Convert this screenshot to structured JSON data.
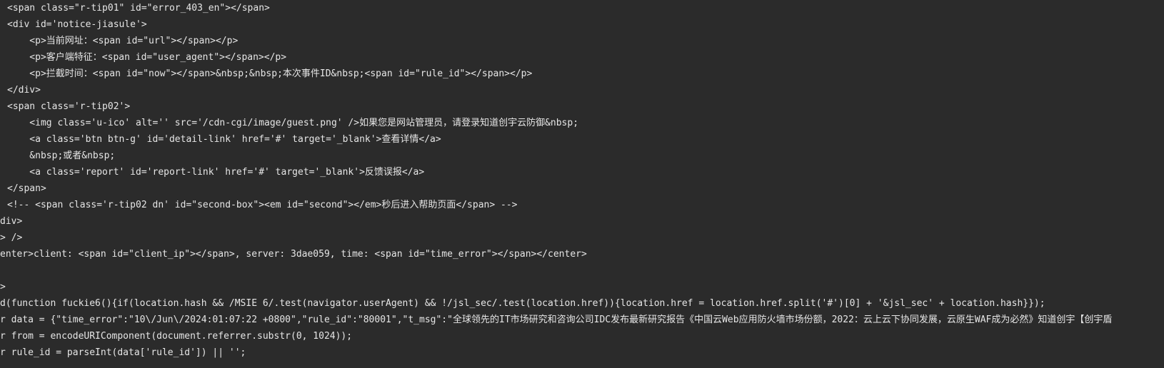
{
  "source_view": {
    "lines": [
      "<span class=\"r-tip01\" id=\"error_403_en\"></span>",
      "<div id='notice-jiasule'>",
      "    <p>当前网址：<span id=\"url\"></span></p>",
      "    <p>客户端特征：<span id=\"user_agent\"></span></p>",
      "    <p>拦截时间：<span id=\"now\"></span>&nbsp;&nbsp;本次事件ID&nbsp;<span id=\"rule_id\"></span></p>",
      "</div>",
      "<span class='r-tip02'>",
      "    <img class='u-ico' alt='' src='/cdn-cgi/image/guest.png' />如果您是网站管理员，请登录知道创宇云防御&nbsp;",
      "    <a class='btn btn-g' id='detail-link' href='#' target='_blank'>查看详情</a>",
      "    &nbsp;或者&nbsp;",
      "    <a class='report' id='report-link' href='#' target='_blank'>反馈误报</a>",
      "</span>",
      "<!-- <span class='r-tip02 dn' id=\"second-box\"><em id=\"second\"></em>秒后进入帮助页面</span> -->",
      "div>",
      "> />",
      "enter>client: <span id=\"client_ip\"></span>, server: 3dae059, time: <span id=\"time_error\"></span></center>",
      "",
      ">",
      "d(function fuckie6(){if(location.hash && /MSIE 6/.test(navigator.userAgent) && !/jsl_sec/.test(location.href)){location.href = location.href.split('#')[0] + '&jsl_sec' + location.hash}});",
      "r data = {\"time_error\":\"10\\/Jun\\/2024:01:07:22 +0800\",\"rule_id\":\"80001\",\"t_msg\":\"全球领先的IT市场研究和咨询公司IDC发布最新研究报告《中国云Web应用防火墙市场份额，2022：云上云下协同发展，云原生WAF成为必然》知道创宇【创宇盾",
      "r from = encodeURIComponent(document.referrer.substr(0, 1024));",
      "r rule_id = parseInt(data['rule_id']) || '';"
    ]
  }
}
